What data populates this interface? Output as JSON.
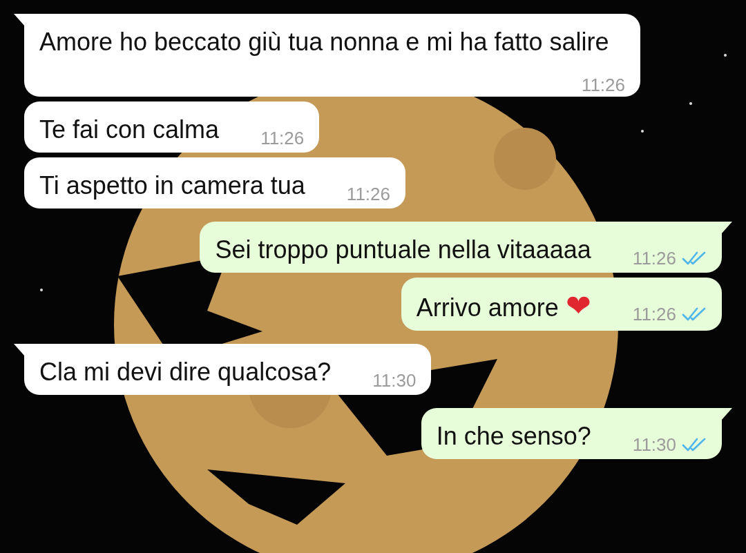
{
  "messages": [
    {
      "kind": "incoming",
      "tail": true,
      "text": "Amore ho beccato giù tua nonna e mi ha fatto salire",
      "time": "11:26"
    },
    {
      "kind": "incoming",
      "tail": false,
      "text": "Te fai con calma",
      "time": "11:26"
    },
    {
      "kind": "incoming",
      "tail": false,
      "text": "Ti aspetto in camera tua",
      "time": "11:26"
    },
    {
      "kind": "outgoing",
      "tail": true,
      "text": "Sei troppo puntuale nella vitaaaaa",
      "time": "11:26",
      "read": true
    },
    {
      "kind": "outgoing",
      "tail": false,
      "text": "Arrivo amore",
      "emoji": "❤",
      "time": "11:26",
      "read": true
    },
    {
      "kind": "incoming",
      "tail": true,
      "text": "Cla mi devi dire qualcosa?",
      "time": "11:30"
    },
    {
      "kind": "outgoing",
      "tail": true,
      "text": "In che senso?",
      "time": "11:30",
      "read": true
    }
  ]
}
